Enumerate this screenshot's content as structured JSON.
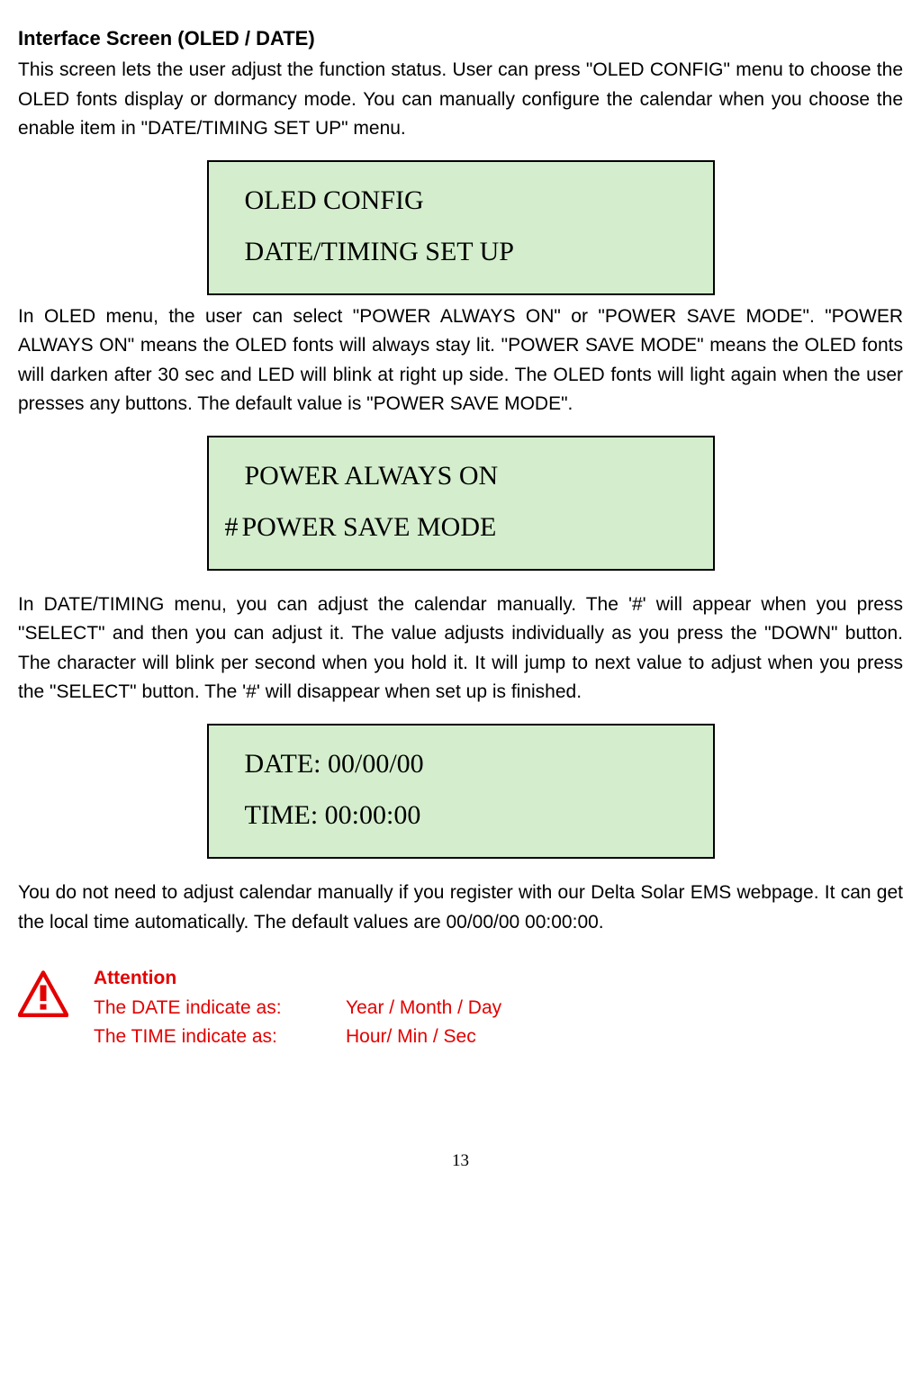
{
  "heading": "Interface Screen (OLED / DATE)",
  "para1": "This screen lets the user adjust the function status. User can press \"OLED CONFIG\" menu to choose the OLED fonts display or dormancy mode. You can manually configure the calendar when you choose the enable item in \"DATE/TIMING SET UP\" menu.",
  "box1": {
    "line1": "OLED CONFIG",
    "line2": "DATE/TIMING SET UP"
  },
  "para2": "In OLED menu, the user can select \"POWER ALWAYS ON\" or \"POWER SAVE MODE\". \"POWER ALWAYS ON\" means the OLED fonts will always stay lit. \"POWER SAVE MODE\" means the OLED fonts will darken after 30 sec and LED will blink at right up side. The OLED fonts will light again when the user presses any buttons. The default value is \"POWER SAVE MODE\".",
  "box2": {
    "line1": "POWER ALWAYS ON",
    "hash": "#",
    "line2": "POWER SAVE MODE"
  },
  "para3": "In DATE/TIMING menu, you can adjust the calendar manually. The '#' will appear when you press \"SELECT\" and then you can adjust it. The value adjusts individually as you press the \"DOWN\" button. The character will blink per second when you hold it. It will jump to next value to adjust when you press the \"SELECT\" button. The '#' will disappear when set up is finished.",
  "box3": {
    "line1": "DATE: 00/00/00",
    "line2": "TIME: 00:00:00"
  },
  "para4": "You do not need to adjust calendar manually if you register with our Delta Solar EMS webpage. It can get the local time automatically. The default values are 00/00/00 00:00:00.",
  "attention": {
    "label": "Attention",
    "row1_key": "The DATE indicate as:",
    "row1_val": "Year / Month / Day",
    "row2_key": "The TIME indicate as:",
    "row2_val": "Hour/ Min / Sec"
  },
  "page_number": "13"
}
